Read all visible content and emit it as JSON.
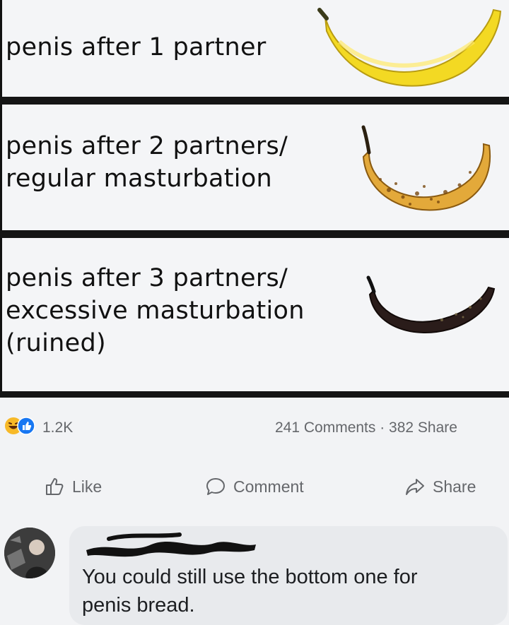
{
  "meme": {
    "rows": [
      {
        "lines": [
          "penis after 1 partner"
        ],
        "banana": "yellow-banana"
      },
      {
        "lines": [
          "penis after 2 partners/",
          "regular masturbation"
        ],
        "banana": "spotted-banana"
      },
      {
        "lines": [
          "penis after 3 partners/",
          "excessive masturbation",
          "(ruined)"
        ],
        "banana": "black-banana"
      }
    ]
  },
  "post_stats": {
    "reaction_count": "1.2K",
    "comments_shares": "241 Comments · 382 Share"
  },
  "actions": {
    "like": "Like",
    "comment": "Comment",
    "share": "Share"
  },
  "comment": {
    "text_line1": "You could still use the bottom one for",
    "text_line2": "penis bread."
  },
  "colors": {
    "banana_yellow": "#f3d923",
    "banana_spotted": "#e3a93a",
    "banana_black": "#2a1c1a",
    "like_blue": "#1877f2",
    "haha_yellow": "#f7b928"
  }
}
